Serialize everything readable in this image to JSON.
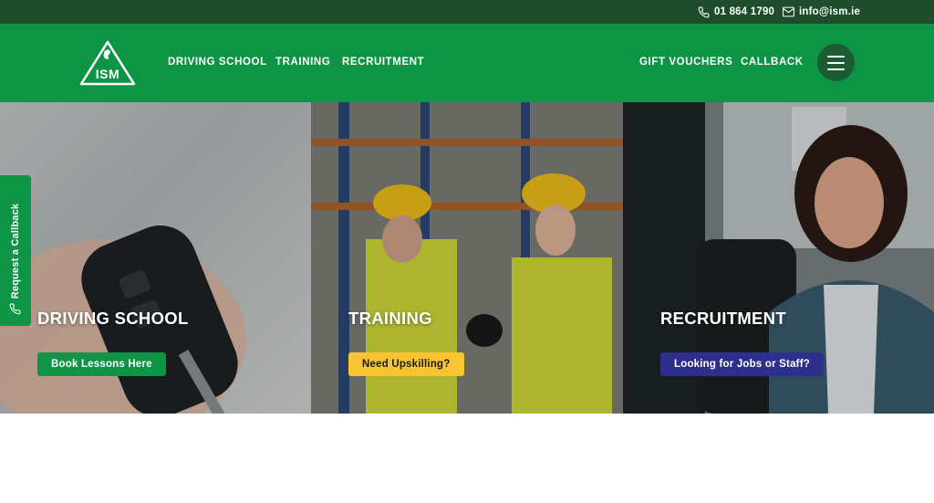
{
  "topbar": {
    "phone": "01 864 1790",
    "email": "info@ism.ie"
  },
  "header": {
    "logo_text": "ISM",
    "nav_left": [
      "DRIVING SCHOOL",
      "TRAINING",
      "RECRUITMENT"
    ],
    "nav_right": [
      "GIFT VOUCHERS",
      "CALLBACK"
    ],
    "menu_icon": "hamburger-icon"
  },
  "callback_tab": {
    "label": "Request a Callback",
    "icon": "phone-icon"
  },
  "panels": [
    {
      "title": "DRIVING SCHOOL",
      "cta": "Book Lessons Here"
    },
    {
      "title": "TRAINING",
      "cta": "Need Upskilling?"
    },
    {
      "title": "RECRUITMENT",
      "cta": "Looking for Jobs or Staff?"
    }
  ],
  "colors": {
    "brand_green": "#0d9444",
    "dark_green": "#1d4d2a",
    "yellow": "#f6c531",
    "navy": "#2e2f8c"
  }
}
